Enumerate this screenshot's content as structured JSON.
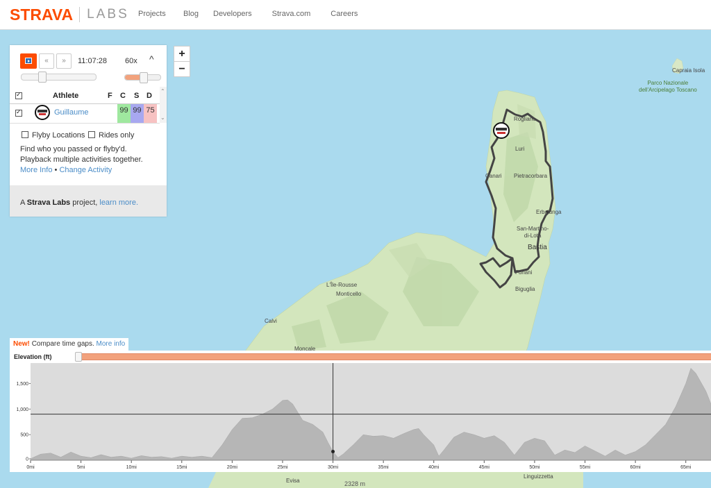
{
  "header": {
    "logo_strava": "STRAVA",
    "logo_labs": "LABS",
    "nav": [
      "Projects",
      "Blog",
      "Developers",
      "Strava.com",
      "Careers"
    ]
  },
  "zoom": {
    "in": "+",
    "out": "−"
  },
  "player": {
    "time": "11:07:28",
    "speed": "60x",
    "rewind_icon": "«",
    "forward_icon": "»",
    "collapse_icon": "^",
    "time_position_fraction": 0.25,
    "speed_fraction": 0.5
  },
  "table": {
    "headers": {
      "athlete": "Athlete",
      "f": "F",
      "c": "C",
      "s": "S",
      "d": "D"
    },
    "rows": [
      {
        "name": "Guillaume",
        "f": "",
        "c": "99",
        "s": "99",
        "d": "75"
      }
    ]
  },
  "options": {
    "flyby": "Flyby Locations",
    "rides": "Rides only"
  },
  "description": "Find who you passed or flyby'd. Playback multiple activities together.",
  "links": {
    "more_info": "More Info",
    "bullet": "•",
    "change_activity": "Change Activity"
  },
  "footer": {
    "prefix": "A",
    "brand": "Strava Labs",
    "suffix": "project,",
    "link": "learn more."
  },
  "map_labels": {
    "capraia": "Capraia Isola",
    "park": "Parco Nazionale\ndell'Arcipelago Toscano",
    "rogliano": "Rogliano",
    "luri": "Luri",
    "canari": "Canari",
    "pietracorbara": "Pietracorbara",
    "erbalunga": "Erbalunga",
    "san_martino": "San-Martino-\ndi-Lota",
    "bastia": "Bastia",
    "ile_rousse": "L'Île-Rousse",
    "monticello": "Monticello",
    "furiani": "Furiani",
    "biguglia": "Biguglia",
    "calvi": "Calvi",
    "moncale": "Moncale",
    "evisa": "Evisa",
    "linguizzetta": "Linguizzetta",
    "peak": "2328 m"
  },
  "elevation_notice": {
    "new": "New!",
    "text": "Compare time gaps.",
    "link": "More info"
  },
  "elevation": {
    "title": "Elevation (ft)",
    "y_ticks": [
      "0",
      "500",
      "1,000",
      "1,500"
    ],
    "y_values": [
      0,
      500,
      1000,
      1500
    ],
    "y_max": 1900,
    "x_max_mi": 67.5,
    "x_ticks": [
      "0mi",
      "5mi",
      "10mi",
      "15mi",
      "20mi",
      "25mi",
      "30mi",
      "35mi",
      "40mi",
      "45mi",
      "50mi",
      "55mi",
      "60mi",
      "65mi"
    ],
    "x_values": [
      0,
      5,
      10,
      15,
      20,
      25,
      30,
      35,
      40,
      45,
      50,
      55,
      60,
      65
    ],
    "cursor_mi": 30,
    "cursor_elev_ft": 170,
    "crosshair_elev_ft": 900,
    "profile": [
      [
        0,
        30
      ],
      [
        1,
        120
      ],
      [
        2,
        140
      ],
      [
        3,
        60
      ],
      [
        4,
        160
      ],
      [
        5,
        80
      ],
      [
        6,
        50
      ],
      [
        7,
        110
      ],
      [
        8,
        60
      ],
      [
        9,
        80
      ],
      [
        10,
        40
      ],
      [
        11,
        90
      ],
      [
        12,
        60
      ],
      [
        13,
        70
      ],
      [
        14,
        40
      ],
      [
        15,
        80
      ],
      [
        16,
        60
      ],
      [
        17,
        80
      ],
      [
        18,
        50
      ],
      [
        19,
        300
      ],
      [
        20,
        600
      ],
      [
        21,
        820
      ],
      [
        22,
        830
      ],
      [
        23,
        900
      ],
      [
        24,
        1000
      ],
      [
        25,
        1170
      ],
      [
        25.5,
        1180
      ],
      [
        26,
        1100
      ],
      [
        27,
        780
      ],
      [
        28,
        700
      ],
      [
        29,
        550
      ],
      [
        29.5,
        350
      ],
      [
        30,
        170
      ],
      [
        30.5,
        50
      ],
      [
        31,
        120
      ],
      [
        32,
        300
      ],
      [
        33,
        500
      ],
      [
        34,
        470
      ],
      [
        35,
        480
      ],
      [
        36,
        430
      ],
      [
        37,
        520
      ],
      [
        38,
        600
      ],
      [
        38.5,
        620
      ],
      [
        39,
        500
      ],
      [
        40,
        300
      ],
      [
        40.5,
        80
      ],
      [
        41,
        200
      ],
      [
        42,
        450
      ],
      [
        43,
        550
      ],
      [
        44,
        500
      ],
      [
        45,
        430
      ],
      [
        46,
        480
      ],
      [
        47,
        350
      ],
      [
        48,
        100
      ],
      [
        49,
        350
      ],
      [
        50,
        430
      ],
      [
        51,
        380
      ],
      [
        52,
        100
      ],
      [
        53,
        200
      ],
      [
        54,
        150
      ],
      [
        55,
        280
      ],
      [
        56,
        180
      ],
      [
        57,
        80
      ],
      [
        58,
        200
      ],
      [
        59,
        100
      ],
      [
        60,
        170
      ],
      [
        61,
        300
      ],
      [
        62,
        500
      ],
      [
        63,
        700
      ],
      [
        64,
        1050
      ],
      [
        65,
        1500
      ],
      [
        65.5,
        1800
      ],
      [
        66,
        1700
      ],
      [
        67,
        1350
      ],
      [
        67.5,
        1100
      ]
    ]
  },
  "colors": {
    "brand": "#fc4c02",
    "link": "#4a8cc7",
    "c_score": "#9fe89f",
    "s_score": "#a8a8f0",
    "d_score": "#f7c2c2"
  }
}
